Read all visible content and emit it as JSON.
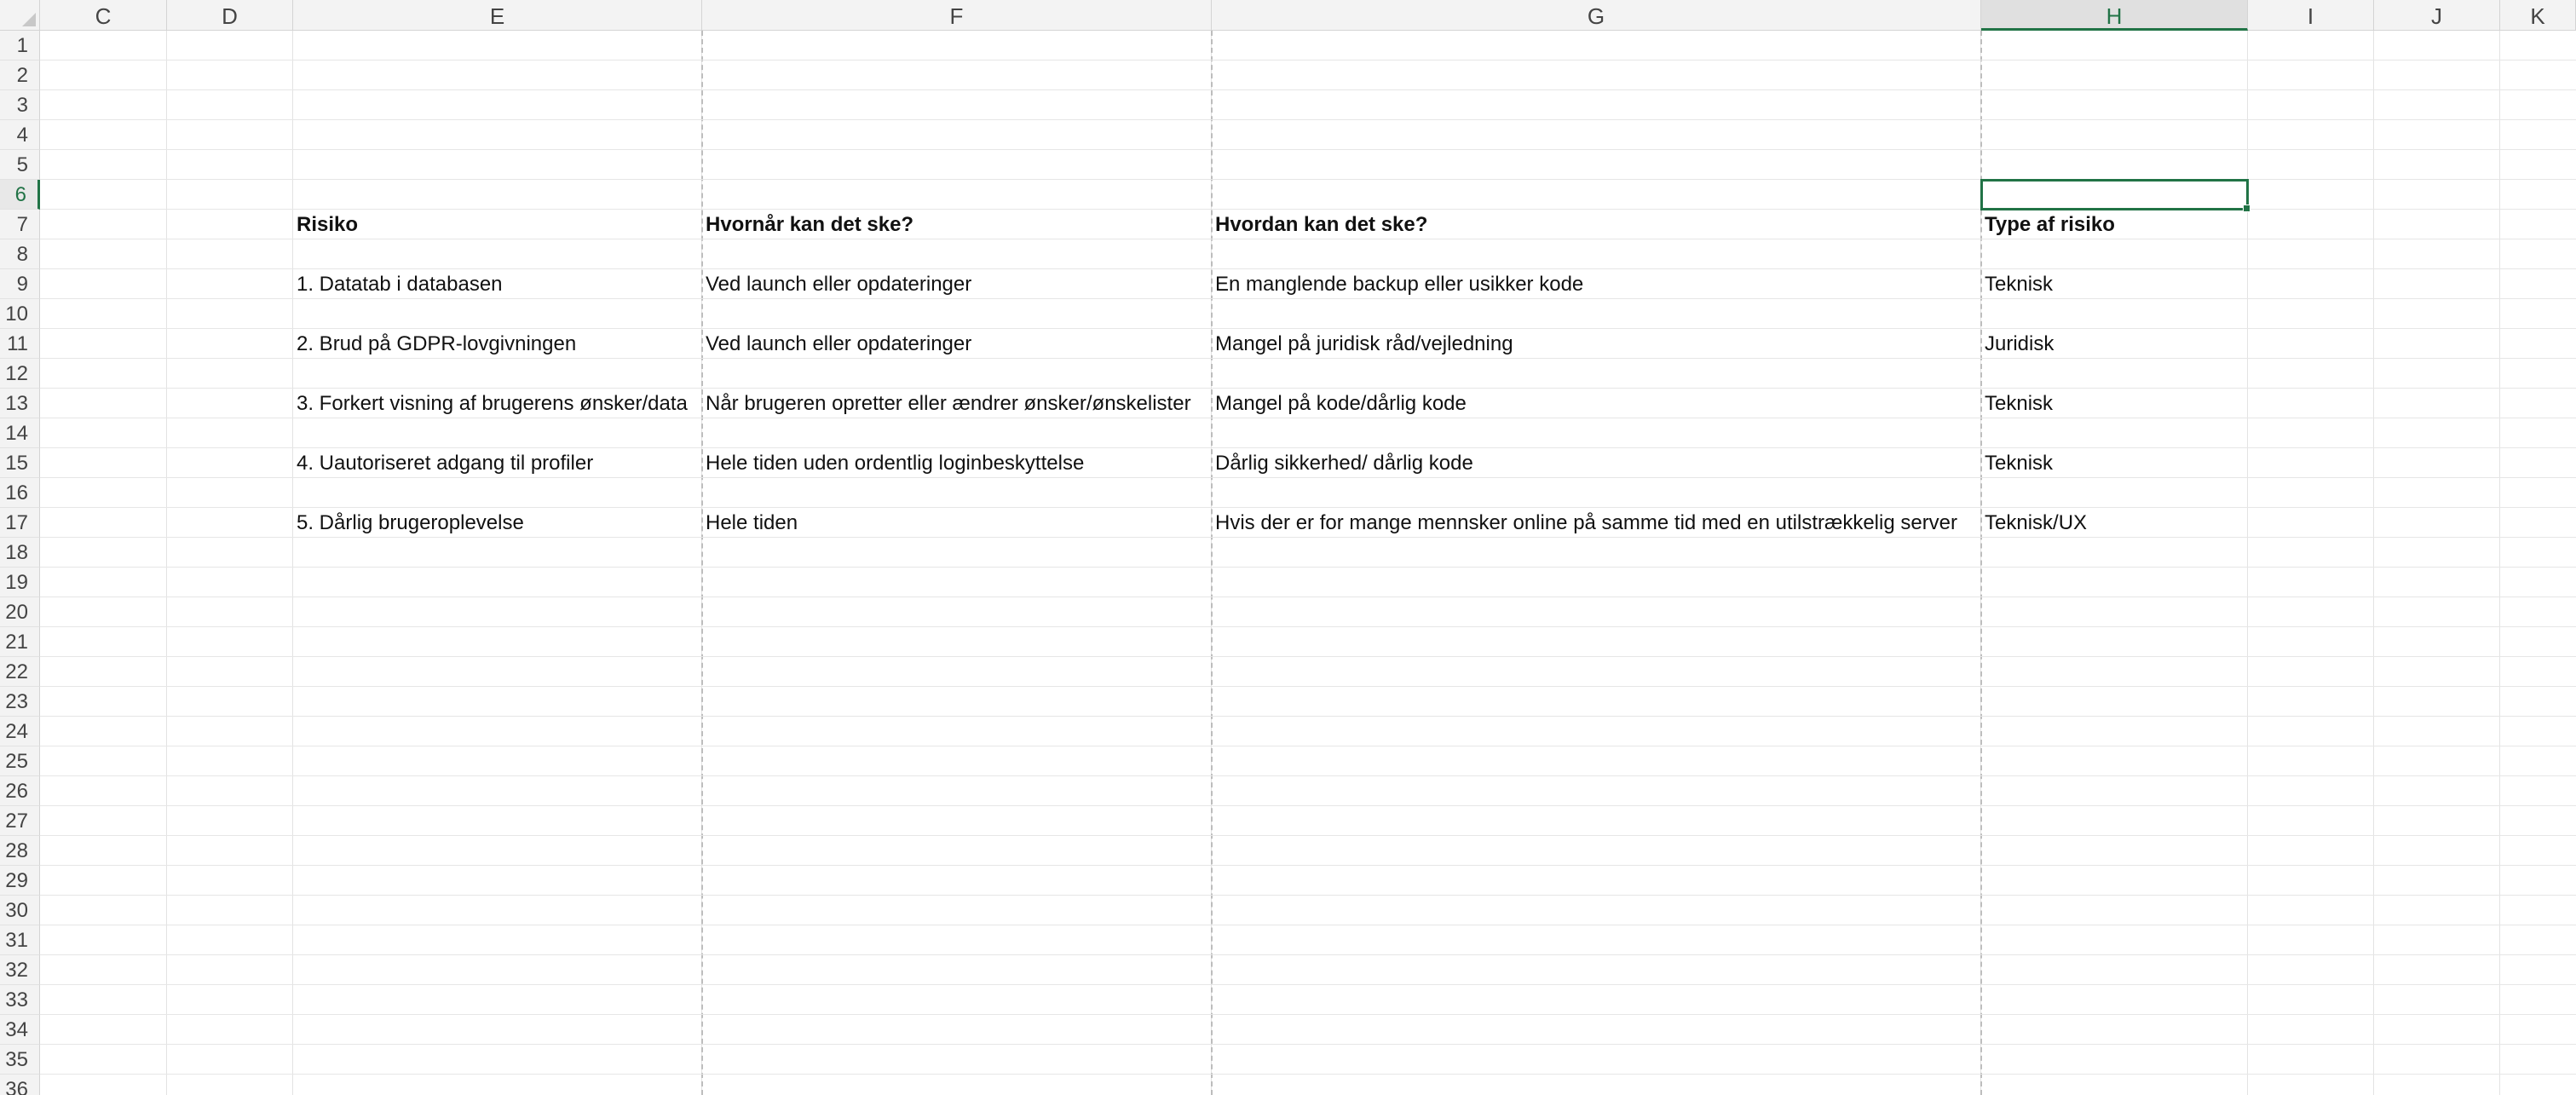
{
  "columns": [
    "C",
    "D",
    "E",
    "F",
    "G",
    "H",
    "I",
    "J",
    "K"
  ],
  "selected_column": "H",
  "rows": [
    "1",
    "2",
    "3",
    "4",
    "5",
    "6",
    "7",
    "8",
    "9",
    "10",
    "11",
    "12",
    "13",
    "14",
    "15",
    "16",
    "17",
    "18",
    "19",
    "20",
    "21",
    "22",
    "23",
    "24",
    "25",
    "26",
    "27",
    "28",
    "29",
    "30",
    "31",
    "32",
    "33",
    "34",
    "35",
    "36"
  ],
  "selected_row": "6",
  "headers": {
    "risk": "Risiko",
    "when": "Hvornår kan det ske?",
    "how": "Hvordan kan det ske?",
    "type": "Type af risiko"
  },
  "risks": [
    {
      "risk": "1. Datatab i databasen",
      "when": "Ved launch eller opdateringer",
      "how": "En manglende backup eller usikker kode",
      "type": "Teknisk"
    },
    {
      "risk": "2. Brud på GDPR-lovgivningen",
      "when": "Ved launch eller opdateringer",
      "how": "Mangel på juridisk råd/vejledning",
      "type": "Juridisk"
    },
    {
      "risk": "3. Forkert visning af brugerens ønsker/data",
      "when": "Når brugeren opretter eller ændrer ønsker/ønskelister",
      "how": "Mangel på kode/dårlig kode",
      "type": "Teknisk"
    },
    {
      "risk": "4. Uautoriseret adgang til profiler",
      "when": "Hele tiden uden ordentlig loginbeskyttelse",
      "how": "Dårlig sikkerhed/ dårlig kode",
      "type": "Teknisk"
    },
    {
      "risk": "5. Dårlig brugeroplevelse",
      "when": "Hele tiden",
      "how": "Hvis der er for mange mennsker online på samme tid med en utilstrækkelig server",
      "type": "Teknisk/UX"
    }
  ],
  "colors": {
    "accent": "#217346",
    "header_bg": "#f3f3f3",
    "gridline": "#e6e6e6"
  }
}
